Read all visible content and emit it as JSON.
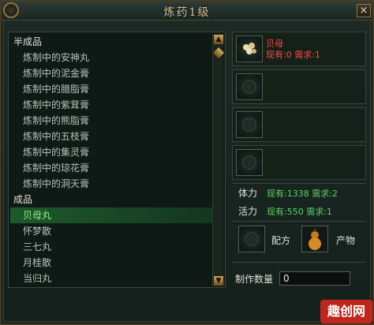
{
  "window": {
    "title": "炼药1级",
    "close": "×"
  },
  "list": {
    "items": [
      {
        "type": "cat",
        "label": "半成品"
      },
      {
        "type": "item",
        "label": "炼制中的安神丸"
      },
      {
        "type": "item",
        "label": "炼制中的泥金膏"
      },
      {
        "type": "item",
        "label": "炼制中的腊脂膏"
      },
      {
        "type": "item",
        "label": "炼制中的紫茸膏"
      },
      {
        "type": "item",
        "label": "炼制中的熊脂膏"
      },
      {
        "type": "item",
        "label": "炼制中的五枝膏"
      },
      {
        "type": "item",
        "label": "炼制中的集灵膏"
      },
      {
        "type": "item",
        "label": "炼制中的琼花膏"
      },
      {
        "type": "item",
        "label": "炼制中的洞天膏"
      },
      {
        "type": "cat",
        "label": "成品"
      },
      {
        "type": "item",
        "label": "贝母丸",
        "selected": true
      },
      {
        "type": "item",
        "label": "怀梦散"
      },
      {
        "type": "item",
        "label": "三七丸"
      },
      {
        "type": "item",
        "label": "月桂散"
      },
      {
        "type": "item",
        "label": "当归丸"
      }
    ]
  },
  "ingredient": {
    "name": "贝母",
    "line": "现有:0  需求:1"
  },
  "stats": {
    "stamina_label": "体力",
    "stamina_text": "现有:1338 需求:2",
    "vitality_label": "活力",
    "vitality_text": "现有:550 需求:1"
  },
  "recipe": {
    "formula_label": "配方",
    "product_label": "产物"
  },
  "qty": {
    "label": "制作数量",
    "value": "0"
  },
  "watermark": "趣创网"
}
